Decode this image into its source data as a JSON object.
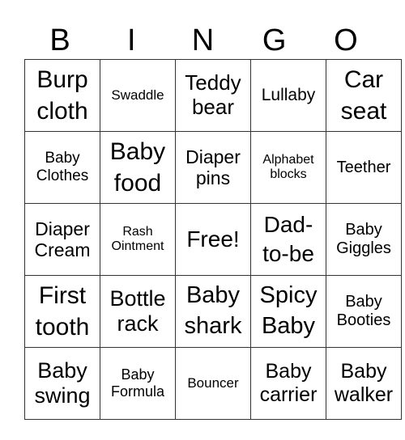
{
  "header": [
    "B",
    "I",
    "N",
    "G",
    "O"
  ],
  "cells": [
    [
      "Burp cloth",
      "Swaddle",
      "Teddy bear",
      "Lullaby",
      "Car seat"
    ],
    [
      "Baby Clothes",
      "Baby food",
      "Diaper pins",
      "Alphabet blocks",
      "Teether"
    ],
    [
      "Diaper Cream",
      "Rash Ointment",
      "Free!",
      "Dad-to-be",
      "Baby Giggles"
    ],
    [
      "First tooth",
      "Bottle rack",
      "Baby shark",
      "Spicy Baby",
      "Baby Booties"
    ],
    [
      "Baby swing",
      "Baby Formula",
      "Bouncer",
      "Baby carrier",
      "Baby walker"
    ]
  ]
}
